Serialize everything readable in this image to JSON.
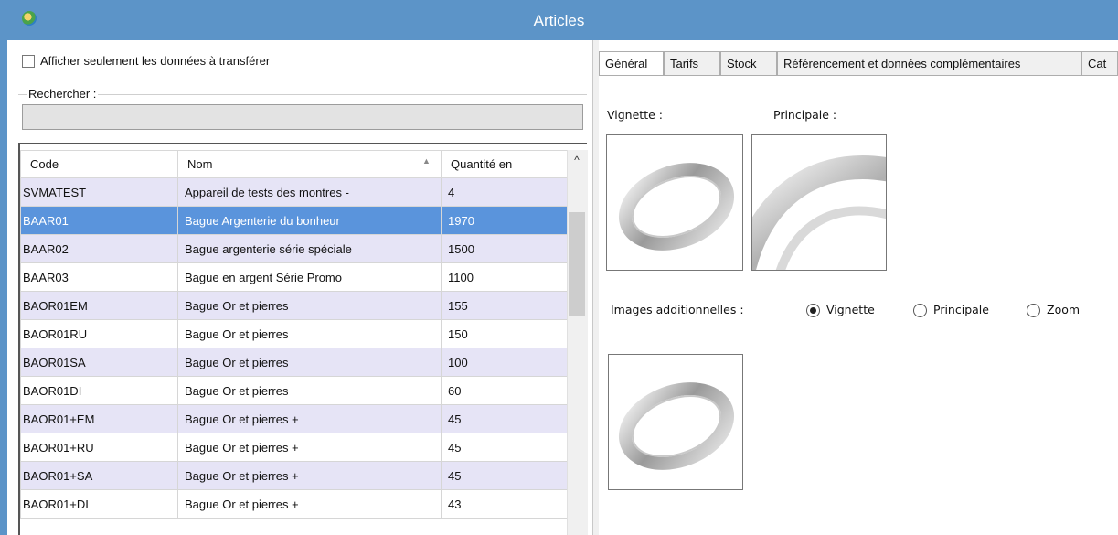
{
  "window": {
    "title": "Articles"
  },
  "left": {
    "checkbox_label": "Afficher seulement les données à transférer",
    "search_label": "Rechercher :",
    "search_value": "",
    "columns": [
      "Code",
      "Nom",
      "Quantité en"
    ],
    "rows": [
      {
        "code": "SVMATEST",
        "nom": "Appareil de tests des montres -",
        "qty": "4"
      },
      {
        "code": "BAAR01",
        "nom": "Bague Argenterie du bonheur",
        "qty": "1970"
      },
      {
        "code": "BAAR02",
        "nom": "Bague argenterie série spéciale",
        "qty": "1500"
      },
      {
        "code": "BAAR03",
        "nom": "Bague en argent Série Promo",
        "qty": "1100"
      },
      {
        "code": "BAOR01EM",
        "nom": "Bague Or et pierres",
        "qty": "155"
      },
      {
        "code": "BAOR01RU",
        "nom": "Bague Or et pierres",
        "qty": "150"
      },
      {
        "code": "BAOR01SA",
        "nom": "Bague Or et pierres",
        "qty": "100"
      },
      {
        "code": "BAOR01DI",
        "nom": "Bague Or et pierres",
        "qty": "60"
      },
      {
        "code": "BAOR01+EM",
        "nom": "Bague Or et pierres +",
        "qty": "45"
      },
      {
        "code": "BAOR01+RU",
        "nom": "Bague Or et pierres +",
        "qty": "45"
      },
      {
        "code": "BAOR01+SA",
        "nom": "Bague Or et pierres +",
        "qty": "45"
      },
      {
        "code": "BAOR01+DI",
        "nom": "Bague Or et pierres +",
        "qty": "43"
      }
    ],
    "selected_row": 1
  },
  "right": {
    "tabs": [
      "Général",
      "Tarifs",
      "Stock",
      "Référencement et données complémentaires",
      "Cat"
    ],
    "active_tab": 0,
    "vignette_label": "Vignette :",
    "principale_label": "Principale :",
    "images_add_label": "Images additionnelles :",
    "radios": [
      {
        "label": "Vignette",
        "checked": true
      },
      {
        "label": "Principale",
        "checked": false
      },
      {
        "label": "Zoom",
        "checked": false
      }
    ]
  },
  "colors": {
    "titlebar": "#5c94c8",
    "row_alt": "#e6e4f6",
    "row_selected": "#5a94dc"
  }
}
